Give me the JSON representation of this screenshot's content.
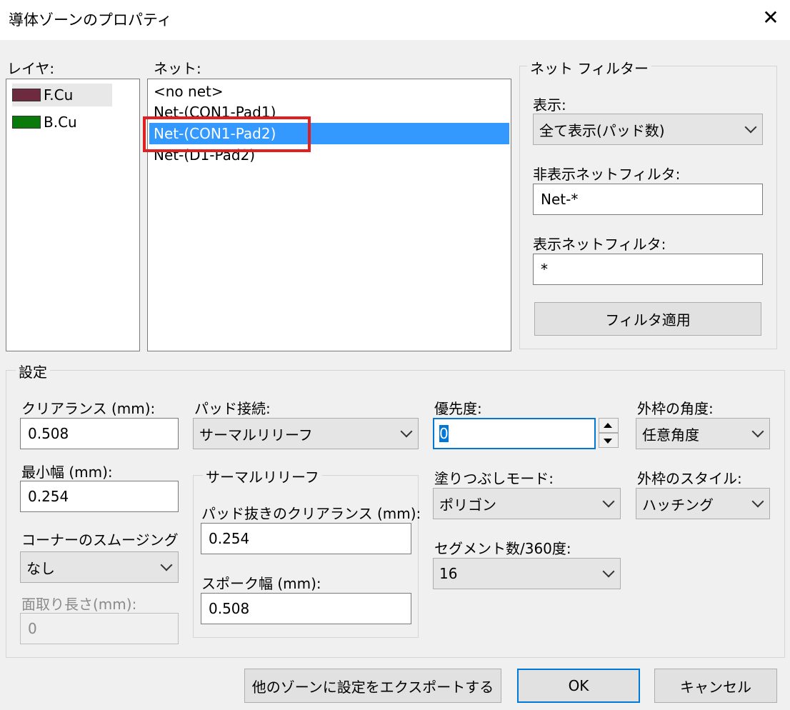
{
  "window": {
    "title": "導体ゾーンのプロパティ",
    "close_icon": "close-icon"
  },
  "layers": {
    "label": "レイヤ:",
    "items": [
      {
        "name": "F.Cu",
        "color": "#6e2a3e"
      },
      {
        "name": "B.Cu",
        "color": "#0a7a0a"
      }
    ]
  },
  "nets": {
    "label": "ネット:",
    "items": [
      "<no net>",
      "Net-(CON1-Pad1)",
      "Net-(CON1-Pad2)",
      "Net-(D1-Pad2)"
    ],
    "selected": "Net-(CON1-Pad2)"
  },
  "net_filter": {
    "legend": "ネット フィルター",
    "display_label": "表示:",
    "display_value": "全て表示(パッド数)",
    "hide_filter_label": "非表示ネットフィルタ:",
    "hide_filter_value": "Net-*",
    "show_filter_label": "表示ネットフィルタ:",
    "show_filter_value": "*",
    "apply_button": "フィルタ適用"
  },
  "settings": {
    "legend": "設定",
    "clearance_label": "クリアランス (mm):",
    "clearance_value": "0.508",
    "min_width_label": "最小幅 (mm):",
    "min_width_value": "0.254",
    "corner_smoothing_label": "コーナーのスムージング",
    "corner_smoothing_value": "なし",
    "chamfer_label": "面取り長さ(mm):",
    "chamfer_value": "0",
    "pad_connection_label": "パッド接続:",
    "pad_connection_value": "サーマルリリーフ",
    "thermal": {
      "legend": "サーマルリリーフ",
      "antipad_label": "パッド抜きのクリアランス (mm):",
      "antipad_value": "0.254",
      "spoke_label": "スポーク幅 (mm):",
      "spoke_value": "0.508"
    },
    "priority_label": "優先度:",
    "priority_value": "0",
    "fill_mode_label": "塗りつぶしモード:",
    "fill_mode_value": "ポリゴン",
    "segments_label": "セグメント数/360度:",
    "segments_value": "16",
    "outline_angle_label": "外枠の角度:",
    "outline_angle_value": "任意角度",
    "outline_style_label": "外枠のスタイル:",
    "outline_style_value": "ハッチング"
  },
  "buttons": {
    "export": "他のゾーンに設定をエクスポートする",
    "ok": "OK",
    "cancel": "キャンセル"
  },
  "colors": {
    "selection": "#3399ff",
    "highlight_box": "#e02020",
    "focus": "#0078d7"
  }
}
